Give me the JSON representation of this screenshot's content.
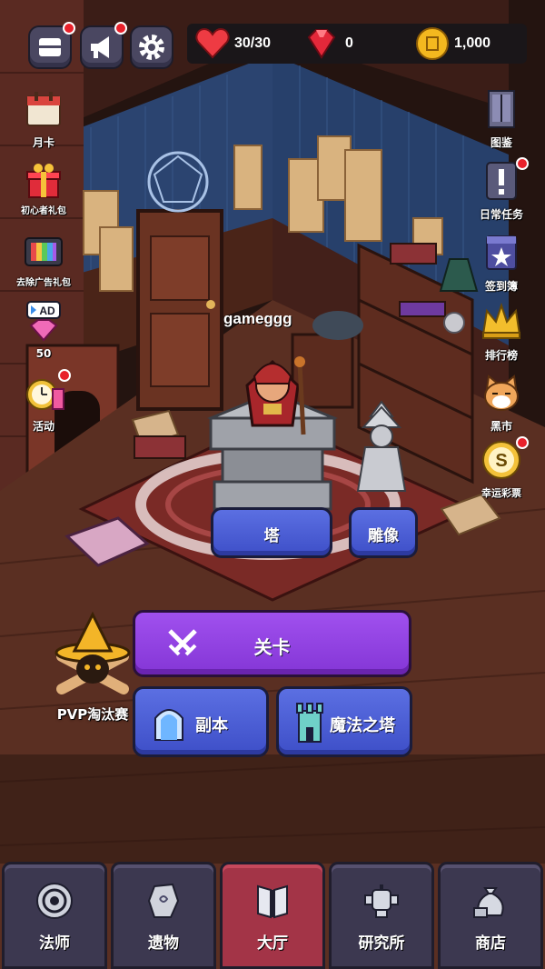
{
  "colors": {
    "accent_purple": "#8e3fe0",
    "button_blue": "#4a5bd8",
    "nav_bg": "#3c3850",
    "nav_active": "#a33447",
    "notify_red": "#e8212b"
  },
  "top_buttons": [
    {
      "name": "mail",
      "icon": "mail-icon",
      "has_notification": true
    },
    {
      "name": "announce",
      "icon": "megaphone-icon",
      "has_notification": true
    },
    {
      "name": "settings",
      "icon": "gear-icon",
      "has_notification": false
    }
  ],
  "resources": {
    "hearts": {
      "icon": "heart-icon",
      "value": "30/30"
    },
    "gems": {
      "icon": "ruby-icon",
      "value": "0"
    },
    "coins": {
      "icon": "coin-icon",
      "value": "1,000"
    }
  },
  "left_sidebar": [
    {
      "label": "月卡",
      "icon": "calendar-icon",
      "has_notification": false
    },
    {
      "label": "初心者礼包",
      "icon": "gift-icon",
      "has_notification": false
    },
    {
      "label": "去除广告礼包",
      "icon": "tv-icon",
      "has_notification": false
    },
    {
      "label": "50",
      "icon": "ad-gem-icon",
      "badge": "AD",
      "has_notification": false
    },
    {
      "label": "活动",
      "icon": "alarm-clock-icon",
      "has_notification": true
    }
  ],
  "right_sidebar": [
    {
      "label": "图鉴",
      "icon": "cabinet-icon",
      "has_notification": false
    },
    {
      "label": "日常任务",
      "icon": "exclamation-icon",
      "has_notification": true
    },
    {
      "label": "签到簿",
      "icon": "star-book-icon",
      "has_notification": false
    },
    {
      "label": "排行榜",
      "icon": "crown-icon",
      "has_notification": false
    },
    {
      "label": "黑市",
      "icon": "cat-icon",
      "has_notification": false
    },
    {
      "label": "幸运彩票",
      "icon": "lottery-coin-icon",
      "badge": "S",
      "has_notification": true
    }
  ],
  "scene": {
    "player_name": "gameggg"
  },
  "actions": {
    "tower_label": "塔",
    "statue_label": "雕像",
    "stage_label": "关卡",
    "dungeon_label": "副本",
    "magic_tower_label": "魔法之塔",
    "pvp_label": "PVP淘汰赛"
  },
  "bottom_nav": [
    {
      "label": "法师",
      "icon": "target-icon",
      "active": false
    },
    {
      "label": "遗物",
      "icon": "stone-icon",
      "active": false
    },
    {
      "label": "大厅",
      "icon": "book-banner-icon",
      "active": true
    },
    {
      "label": "研究所",
      "icon": "robot-icon",
      "active": false
    },
    {
      "label": "商店",
      "icon": "money-bag-icon",
      "active": false
    }
  ]
}
